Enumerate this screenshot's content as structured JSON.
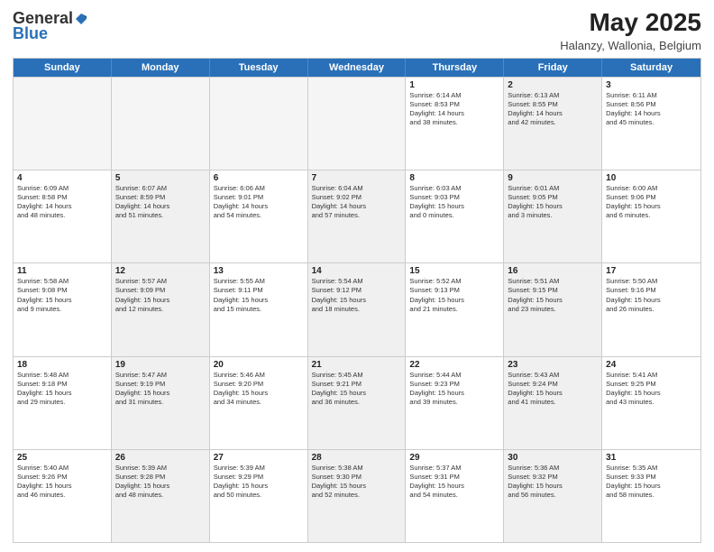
{
  "header": {
    "logo_general": "General",
    "logo_blue": "Blue",
    "month_title": "May 2025",
    "location": "Halanzy, Wallonia, Belgium"
  },
  "weekdays": [
    "Sunday",
    "Monday",
    "Tuesday",
    "Wednesday",
    "Thursday",
    "Friday",
    "Saturday"
  ],
  "rows": [
    [
      {
        "day": "",
        "text": "",
        "empty": true
      },
      {
        "day": "",
        "text": "",
        "empty": true
      },
      {
        "day": "",
        "text": "",
        "empty": true
      },
      {
        "day": "",
        "text": "",
        "empty": true
      },
      {
        "day": "1",
        "text": "Sunrise: 6:14 AM\nSunset: 8:53 PM\nDaylight: 14 hours\nand 38 minutes.",
        "empty": false,
        "shaded": false
      },
      {
        "day": "2",
        "text": "Sunrise: 6:13 AM\nSunset: 8:55 PM\nDaylight: 14 hours\nand 42 minutes.",
        "empty": false,
        "shaded": true
      },
      {
        "day": "3",
        "text": "Sunrise: 6:11 AM\nSunset: 8:56 PM\nDaylight: 14 hours\nand 45 minutes.",
        "empty": false,
        "shaded": false
      }
    ],
    [
      {
        "day": "4",
        "text": "Sunrise: 6:09 AM\nSunset: 8:58 PM\nDaylight: 14 hours\nand 48 minutes.",
        "empty": false,
        "shaded": false
      },
      {
        "day": "5",
        "text": "Sunrise: 6:07 AM\nSunset: 8:59 PM\nDaylight: 14 hours\nand 51 minutes.",
        "empty": false,
        "shaded": true
      },
      {
        "day": "6",
        "text": "Sunrise: 6:06 AM\nSunset: 9:01 PM\nDaylight: 14 hours\nand 54 minutes.",
        "empty": false,
        "shaded": false
      },
      {
        "day": "7",
        "text": "Sunrise: 6:04 AM\nSunset: 9:02 PM\nDaylight: 14 hours\nand 57 minutes.",
        "empty": false,
        "shaded": true
      },
      {
        "day": "8",
        "text": "Sunrise: 6:03 AM\nSunset: 9:03 PM\nDaylight: 15 hours\nand 0 minutes.",
        "empty": false,
        "shaded": false
      },
      {
        "day": "9",
        "text": "Sunrise: 6:01 AM\nSunset: 9:05 PM\nDaylight: 15 hours\nand 3 minutes.",
        "empty": false,
        "shaded": true
      },
      {
        "day": "10",
        "text": "Sunrise: 6:00 AM\nSunset: 9:06 PM\nDaylight: 15 hours\nand 6 minutes.",
        "empty": false,
        "shaded": false
      }
    ],
    [
      {
        "day": "11",
        "text": "Sunrise: 5:58 AM\nSunset: 9:08 PM\nDaylight: 15 hours\nand 9 minutes.",
        "empty": false,
        "shaded": false
      },
      {
        "day": "12",
        "text": "Sunrise: 5:57 AM\nSunset: 9:09 PM\nDaylight: 15 hours\nand 12 minutes.",
        "empty": false,
        "shaded": true
      },
      {
        "day": "13",
        "text": "Sunrise: 5:55 AM\nSunset: 9:11 PM\nDaylight: 15 hours\nand 15 minutes.",
        "empty": false,
        "shaded": false
      },
      {
        "day": "14",
        "text": "Sunrise: 5:54 AM\nSunset: 9:12 PM\nDaylight: 15 hours\nand 18 minutes.",
        "empty": false,
        "shaded": true
      },
      {
        "day": "15",
        "text": "Sunrise: 5:52 AM\nSunset: 9:13 PM\nDaylight: 15 hours\nand 21 minutes.",
        "empty": false,
        "shaded": false
      },
      {
        "day": "16",
        "text": "Sunrise: 5:51 AM\nSunset: 9:15 PM\nDaylight: 15 hours\nand 23 minutes.",
        "empty": false,
        "shaded": true
      },
      {
        "day": "17",
        "text": "Sunrise: 5:50 AM\nSunset: 9:16 PM\nDaylight: 15 hours\nand 26 minutes.",
        "empty": false,
        "shaded": false
      }
    ],
    [
      {
        "day": "18",
        "text": "Sunrise: 5:48 AM\nSunset: 9:18 PM\nDaylight: 15 hours\nand 29 minutes.",
        "empty": false,
        "shaded": false
      },
      {
        "day": "19",
        "text": "Sunrise: 5:47 AM\nSunset: 9:19 PM\nDaylight: 15 hours\nand 31 minutes.",
        "empty": false,
        "shaded": true
      },
      {
        "day": "20",
        "text": "Sunrise: 5:46 AM\nSunset: 9:20 PM\nDaylight: 15 hours\nand 34 minutes.",
        "empty": false,
        "shaded": false
      },
      {
        "day": "21",
        "text": "Sunrise: 5:45 AM\nSunset: 9:21 PM\nDaylight: 15 hours\nand 36 minutes.",
        "empty": false,
        "shaded": true
      },
      {
        "day": "22",
        "text": "Sunrise: 5:44 AM\nSunset: 9:23 PM\nDaylight: 15 hours\nand 39 minutes.",
        "empty": false,
        "shaded": false
      },
      {
        "day": "23",
        "text": "Sunrise: 5:43 AM\nSunset: 9:24 PM\nDaylight: 15 hours\nand 41 minutes.",
        "empty": false,
        "shaded": true
      },
      {
        "day": "24",
        "text": "Sunrise: 5:41 AM\nSunset: 9:25 PM\nDaylight: 15 hours\nand 43 minutes.",
        "empty": false,
        "shaded": false
      }
    ],
    [
      {
        "day": "25",
        "text": "Sunrise: 5:40 AM\nSunset: 9:26 PM\nDaylight: 15 hours\nand 46 minutes.",
        "empty": false,
        "shaded": false
      },
      {
        "day": "26",
        "text": "Sunrise: 5:39 AM\nSunset: 9:28 PM\nDaylight: 15 hours\nand 48 minutes.",
        "empty": false,
        "shaded": true
      },
      {
        "day": "27",
        "text": "Sunrise: 5:39 AM\nSunset: 9:29 PM\nDaylight: 15 hours\nand 50 minutes.",
        "empty": false,
        "shaded": false
      },
      {
        "day": "28",
        "text": "Sunrise: 5:38 AM\nSunset: 9:30 PM\nDaylight: 15 hours\nand 52 minutes.",
        "empty": false,
        "shaded": true
      },
      {
        "day": "29",
        "text": "Sunrise: 5:37 AM\nSunset: 9:31 PM\nDaylight: 15 hours\nand 54 minutes.",
        "empty": false,
        "shaded": false
      },
      {
        "day": "30",
        "text": "Sunrise: 5:36 AM\nSunset: 9:32 PM\nDaylight: 15 hours\nand 56 minutes.",
        "empty": false,
        "shaded": true
      },
      {
        "day": "31",
        "text": "Sunrise: 5:35 AM\nSunset: 9:33 PM\nDaylight: 15 hours\nand 58 minutes.",
        "empty": false,
        "shaded": false
      }
    ]
  ]
}
